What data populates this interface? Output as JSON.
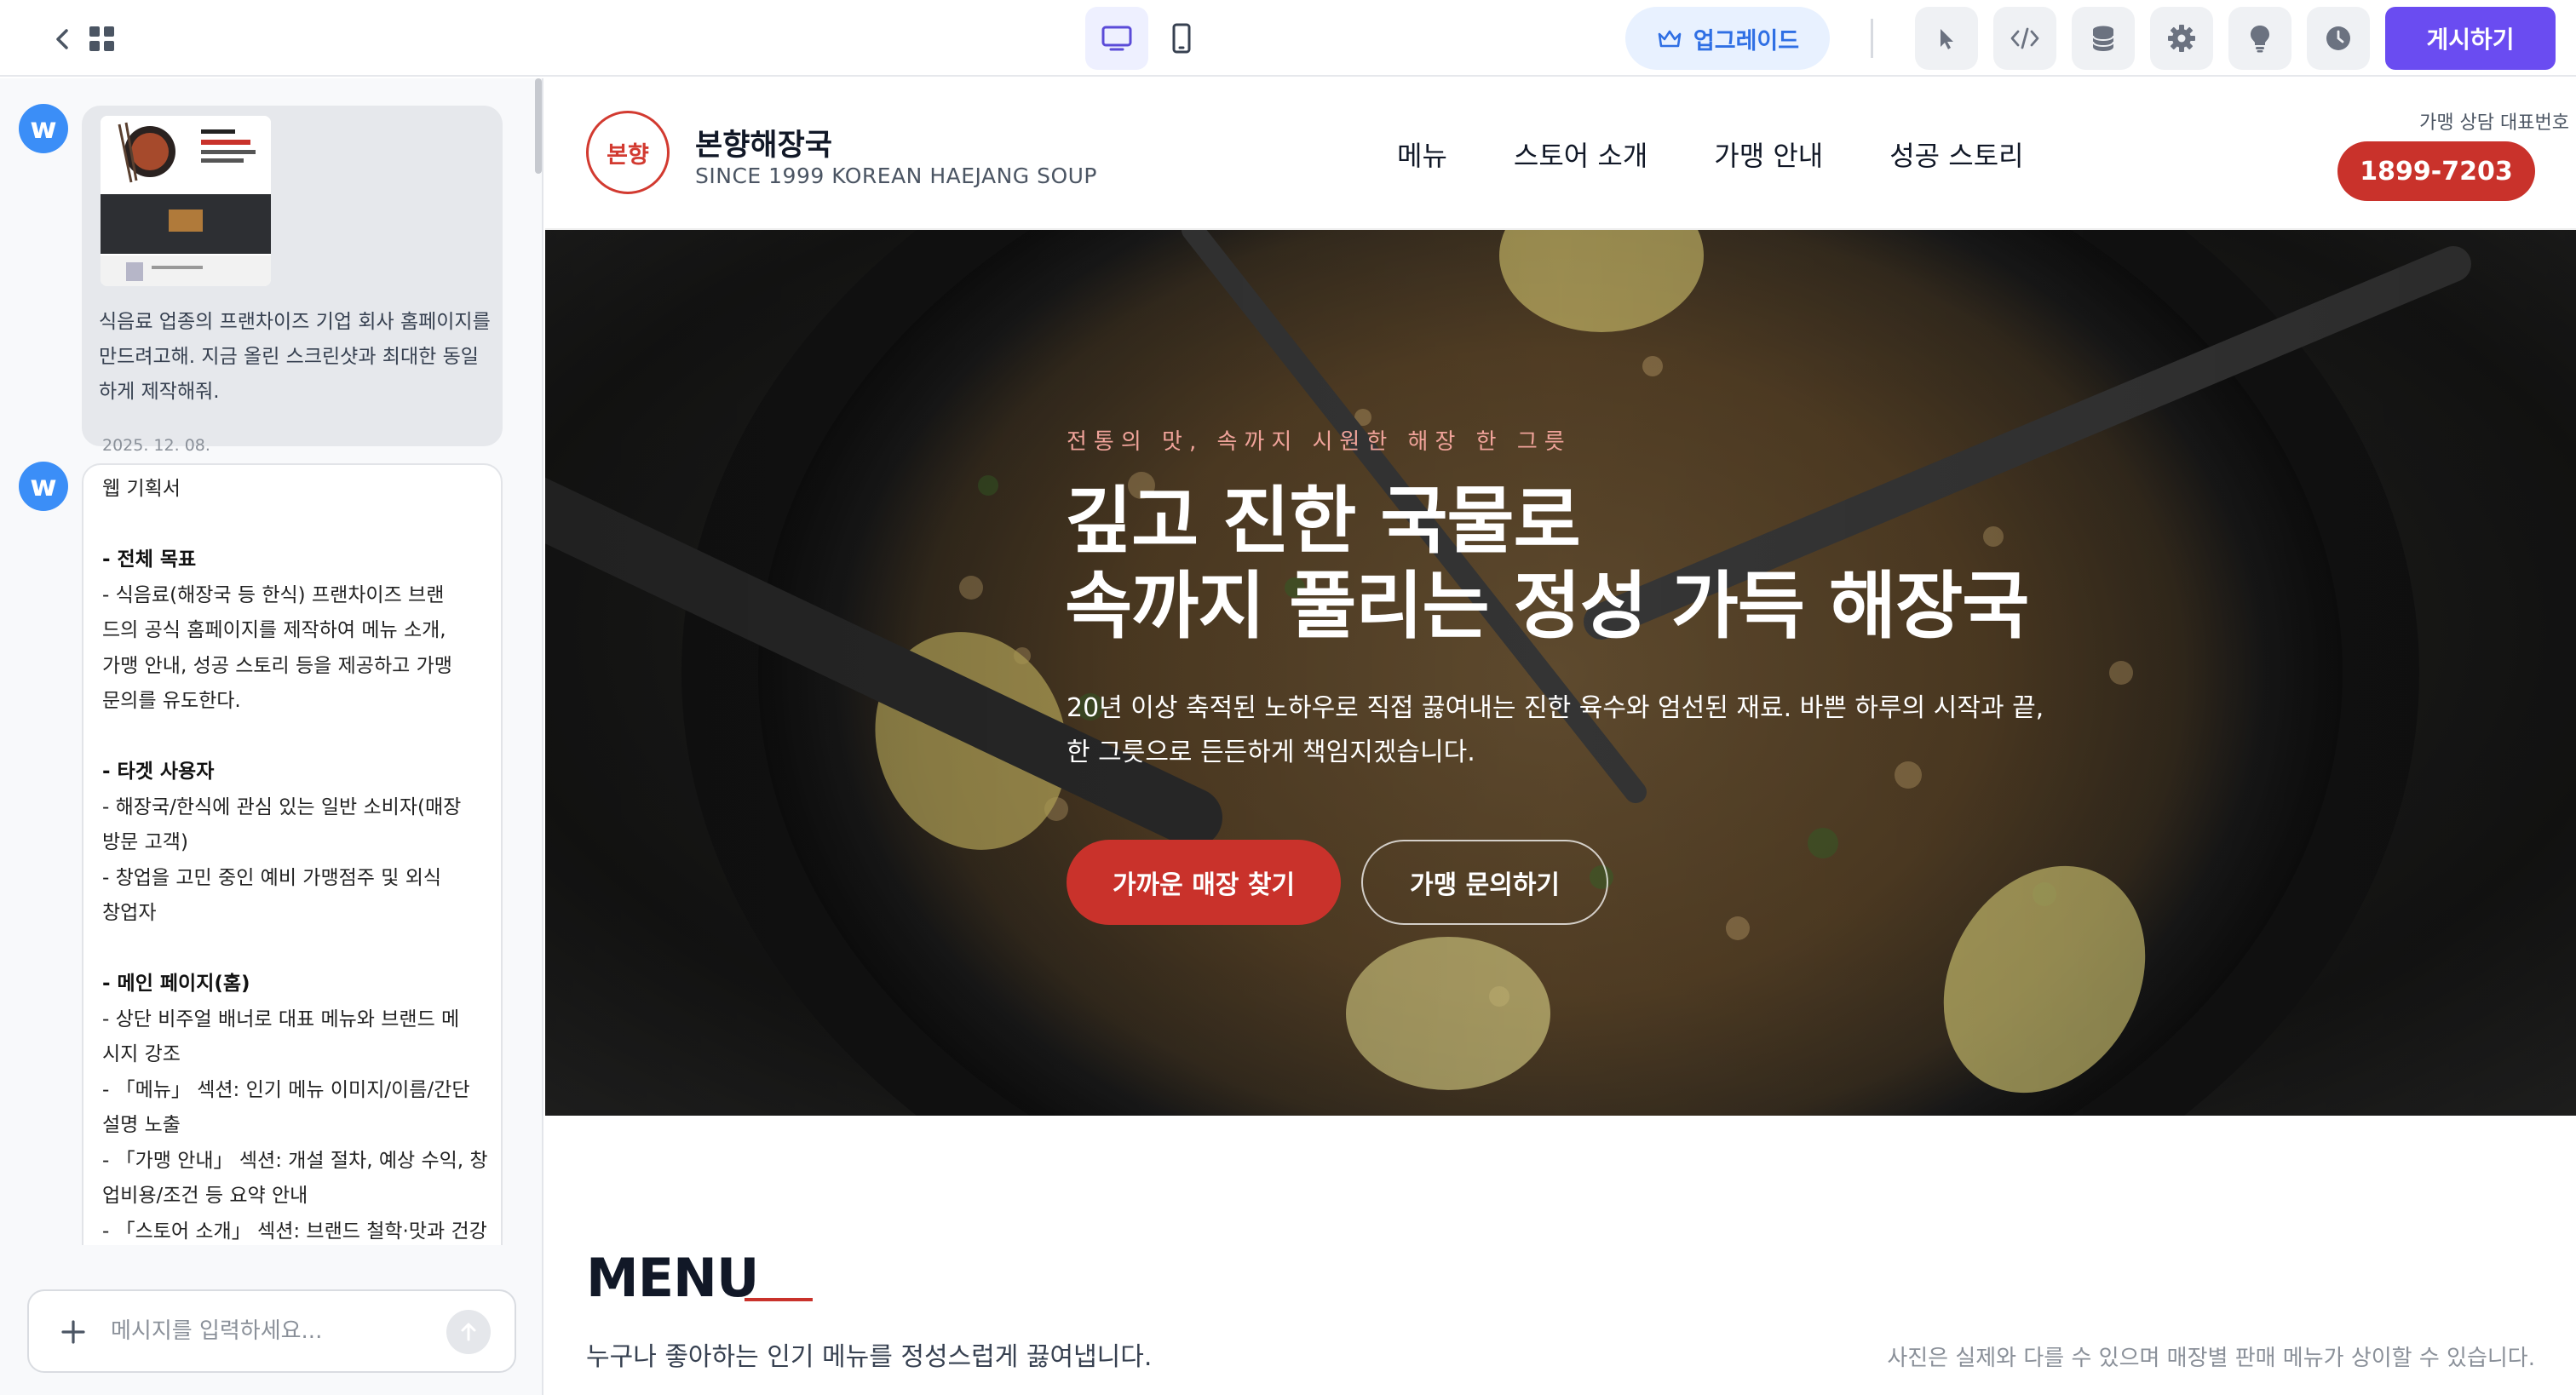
{
  "toolbar": {
    "upgrade_label": "업그레이드",
    "publish_label": "게시하기",
    "accent": "#6a4cf1"
  },
  "chat": {
    "user_message": {
      "text": "식음료 업종의 프랜차이즈 기업 회사 홈페이지를 만드려고해. 지금 올린 스크린샷과 최대한 동일하게 제작해줘.",
      "date": "2025. 12. 08."
    },
    "ai_message": {
      "lines": [
        {
          "text": "웹 기획서",
          "bold": false
        },
        {
          "text": "",
          "bold": false
        },
        {
          "text": "- 전체 목표",
          "bold": true
        },
        {
          "text": "- 식음료(해장국 등 한식) 프랜차이즈 브랜",
          "bold": false
        },
        {
          "text": "드의 공식 홈페이지를 제작하여 메뉴 소개,",
          "bold": false
        },
        {
          "text": "가맹 안내, 성공 스토리 등을 제공하고 가맹",
          "bold": false
        },
        {
          "text": "문의를 유도한다.",
          "bold": false
        },
        {
          "text": "",
          "bold": false
        },
        {
          "text": "- 타겟 사용자",
          "bold": true
        },
        {
          "text": "- 해장국/한식에 관심 있는 일반 소비자(매장",
          "bold": false
        },
        {
          "text": "방문 고객)",
          "bold": false
        },
        {
          "text": "- 창업을 고민 중인 예비 가맹점주 및 외식",
          "bold": false
        },
        {
          "text": "창업자",
          "bold": false
        },
        {
          "text": "",
          "bold": false
        },
        {
          "text": "- 메인 페이지(홈)",
          "bold": true
        },
        {
          "text": "- 상단 비주얼 배너로 대표 메뉴와 브랜드 메",
          "bold": false
        },
        {
          "text": "시지 강조",
          "bold": false
        },
        {
          "text": "- 「메뉴」 섹션: 인기 메뉴 이미지/이름/간단",
          "bold": false
        },
        {
          "text": "설명 노출",
          "bold": false
        },
        {
          "text": "- 「가맹 안내」 섹션: 개설 절차, 예상 수익, 창",
          "bold": false
        },
        {
          "text": "업비용/조건 등 요약 안내",
          "bold": false
        },
        {
          "text": "- 「스토어 소개」 섹션: 브랜드 철학·맛과 건강",
          "bold": false
        }
      ]
    },
    "input": {
      "placeholder": "메시지를 입력하세요..."
    }
  },
  "site": {
    "logo_text": "본향",
    "brand_name": "본향해장국",
    "brand_sub": "SINCE 1999 KOREAN HAEJANG SOUP",
    "nav": [
      "메뉴",
      "스토어 소개",
      "가맹 안내",
      "성공 스토리"
    ],
    "hotline_label": "가맹 상담 대표번호",
    "hotline_number": "1899-7203",
    "brand_color": "#c9322b",
    "hero": {
      "eyebrow": "전통의 맛, 속까지 시원한 해장 한 그릇",
      "title_line1": "깊고 진한 국물로",
      "title_line2": "속까지 풀리는 정성 가득 해장국",
      "desc_line1": "20년 이상 축적된 노하우로 직접 끓여내는 진한 육수와 엄선된 재료. 바쁜 하루의 시작과 끝,",
      "desc_line2": "한 그릇으로 든든하게 책임지겠습니다.",
      "primary_cta": "가까운 매장 찾기",
      "secondary_cta": "가맹 문의하기"
    },
    "menu_section": {
      "title": "MENU",
      "subtitle": "누구나 좋아하는 인기 메뉴를 정성스럽게 끓여냅니다.",
      "note": "사진은 실제와 다를 수 있으며 매장별 판매 메뉴가 상이할 수 있습니다."
    }
  }
}
